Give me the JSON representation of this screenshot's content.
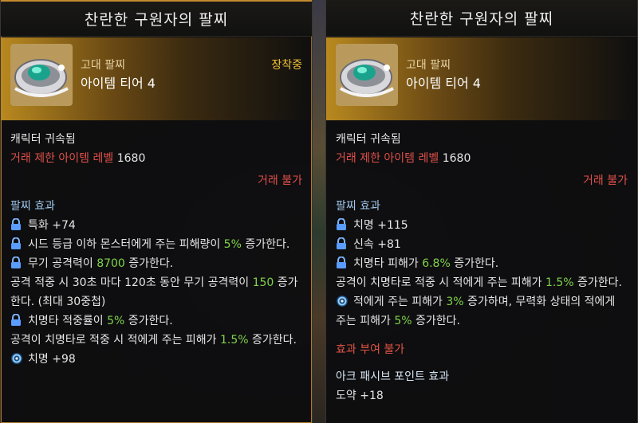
{
  "left": {
    "title": "찬란한 구원자의 팔찌",
    "grade": "고대 팔찌",
    "tier": "아이템 티어 4",
    "equipped": "장착중",
    "bound": "캐릭터 귀속됨",
    "trade_limit_label": "거래 제한 아이템 레벨",
    "trade_limit_value": "1680",
    "trade_status": "거래 불가",
    "effect_section": "팔찌 효과",
    "stat1": "특화 +74",
    "e2_pre": "시드 등급 이하 몬스터에게 주는 피해량이 ",
    "e2_val": "5%",
    "e2_post": " 증가한다.",
    "e3_pre": "무기 공격력이 ",
    "e3_val": "8700",
    "e3_post": " 증가한다.",
    "e3b_pre": "공격 적중 시 30초 마다 120초 동안 무기 공격력이 ",
    "e3b_val": "150",
    "e3b_post": " 증가한다. (최대 30중첩)",
    "e4_pre": "치명타 적중률이 ",
    "e4_val": "5%",
    "e4_post": " 증가한다.",
    "e4b_pre": "공격이 치명타로 적중 시 적에게 주는 피해가 ",
    "e4b_val": "1.5%",
    "e4b_post": " 증가한다.",
    "stat_last": "치명 +98"
  },
  "right": {
    "title": "찬란한 구원자의 팔찌",
    "grade": "고대 팔찌",
    "tier": "아이템 티어 4",
    "bound": "캐릭터 귀속됨",
    "trade_limit_label": "거래 제한 아이템 레벨",
    "trade_limit_value": "1680",
    "trade_status": "거래 불가",
    "effect_section": "팔찌 효과",
    "stat1": "치명 +115",
    "stat2": "신속 +81",
    "e3_pre": "치명타 피해가 ",
    "e3_val": "6.8%",
    "e3_post": " 증가한다.",
    "e3b_pre": "공격이 치명타로 적중 시 적에게 주는 피해가 ",
    "e3b_val": "1.5%",
    "e3b_post": " 증가한다.",
    "e4_pre": "적에게 주는 피해가 ",
    "e4_val": "3%",
    "e4_mid": " 증가하며, 무력화 상태의 적에게 주는 피해가 ",
    "e4_val2": "5%",
    "e4_post": " 증가한다.",
    "no_effect": "효과 부여 불가",
    "ark_title": "아크 패시브 포인트 효과",
    "ark_partial": "도약 +18"
  },
  "colors": {
    "accent_gold": "#f2c23a",
    "red": "#e0504a",
    "green": "#7fd44a",
    "section_blue": "#9fc6ec"
  },
  "icons": [
    "lock-icon",
    "swirl-effect-icon",
    "bracelet-item-icon"
  ]
}
